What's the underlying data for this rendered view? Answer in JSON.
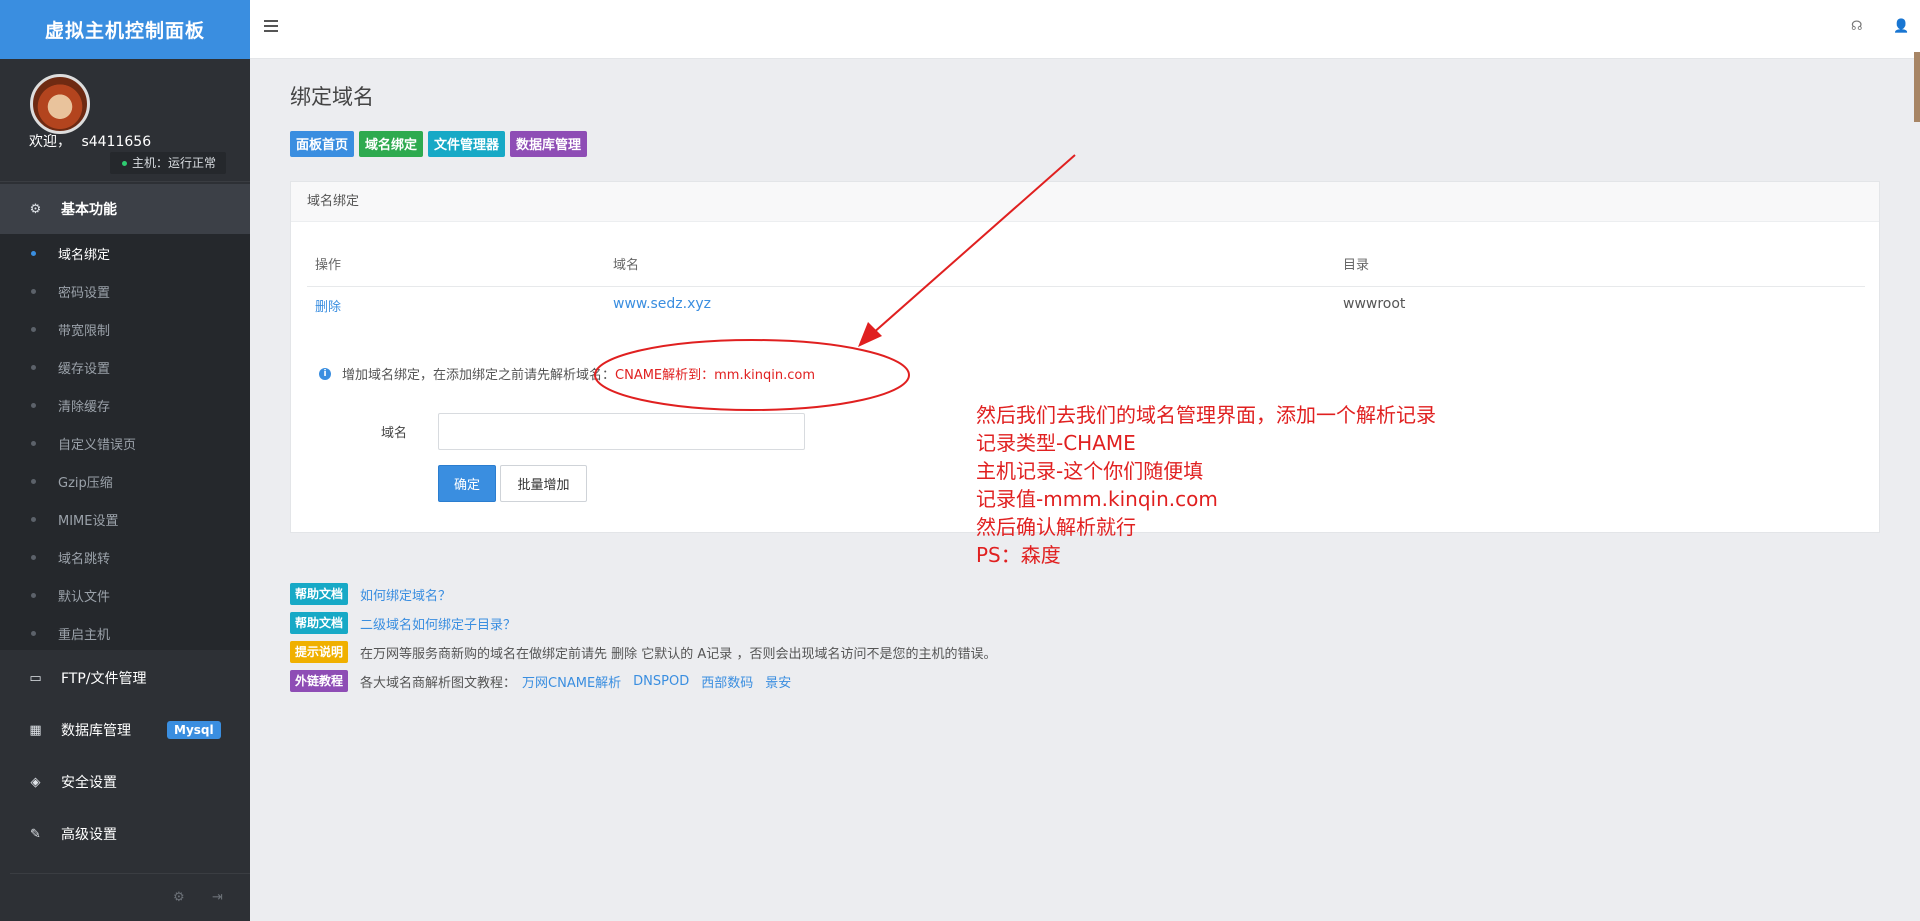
{
  "brand": {
    "title": "虚拟主机控制面板"
  },
  "user": {
    "welcome": "欢迎，",
    "username": "s4411656",
    "status": "主机：运行正常"
  },
  "sidebar": {
    "sections": [
      {
        "label": "基本功能",
        "icon": "cogs-icon"
      },
      {
        "label": "FTP/文件管理",
        "icon": "folder-open-icon"
      },
      {
        "label": "数据库管理",
        "icon": "table-icon",
        "badge": "Mysql"
      },
      {
        "label": "安全设置",
        "icon": "shield-icon"
      },
      {
        "label": "高级设置",
        "icon": "edit-icon"
      }
    ],
    "items": [
      {
        "label": "域名绑定",
        "current": true
      },
      {
        "label": "密码设置"
      },
      {
        "label": "带宽限制"
      },
      {
        "label": "缓存设置"
      },
      {
        "label": "清除缓存"
      },
      {
        "label": "自定义错误页"
      },
      {
        "label": "Gzip压缩"
      },
      {
        "label": "MIME设置"
      },
      {
        "label": "域名跳转"
      },
      {
        "label": "默认文件"
      },
      {
        "label": "重启主机"
      }
    ],
    "footer_icons": [
      "gear-icon",
      "logout-icon"
    ]
  },
  "topbar": {
    "icons": [
      "headset-icon",
      "user-icon"
    ]
  },
  "page": {
    "title": "绑定域名"
  },
  "quick_buttons": [
    {
      "label": "面板首页",
      "color": "#3a8ee0"
    },
    {
      "label": "域名绑定",
      "color": "#2eaa4f"
    },
    {
      "label": "文件管理器",
      "color": "#17a9c6"
    },
    {
      "label": "数据库管理",
      "color": "#8e4db5"
    }
  ],
  "panel": {
    "title": "域名绑定",
    "columns": [
      "操作",
      "域名",
      "目录"
    ],
    "rows": [
      {
        "action": "删除",
        "domain": "www.sedz.xyz",
        "dir": "wwwroot"
      }
    ],
    "info_text": "增加域名绑定，在添加绑定之前请先解析域名：",
    "info_cname": "CNAME解析到：mm.kinqin.com",
    "form_label": "域名",
    "input_value": "",
    "submit_label": "确定",
    "batch_label": "批量增加"
  },
  "help": [
    {
      "tag": "帮助文档",
      "tag_color": "#17a9c6",
      "links": [
        "如何绑定域名？"
      ]
    },
    {
      "tag": "帮助文档",
      "tag_color": "#17a9c6",
      "links": [
        "二级域名如何绑定子目录？"
      ]
    },
    {
      "tag": "提示说明",
      "tag_color": "#f0b000",
      "text": "在万网等服务商新购的域名在做绑定前请先 删除 它默认的 A记录 ，否则会出现域名访问不是您的主机的错误。"
    },
    {
      "tag": "外链教程",
      "tag_color": "#8e4db5",
      "text": "各大域名商解析图文教程：",
      "links": [
        "万网CNAME解析",
        "DNSPOD",
        "西部数码",
        "景安"
      ]
    }
  ],
  "annotation": {
    "lines": [
      "然后我们去我们的域名管理界面，添加一个解析记录",
      "记录类型-CHAME",
      "主机记录-这个你们随便填",
      "记录值-mmm.kinqin.com",
      "然后确认解析就行",
      "PS：森度"
    ],
    "color": "#e02020"
  }
}
